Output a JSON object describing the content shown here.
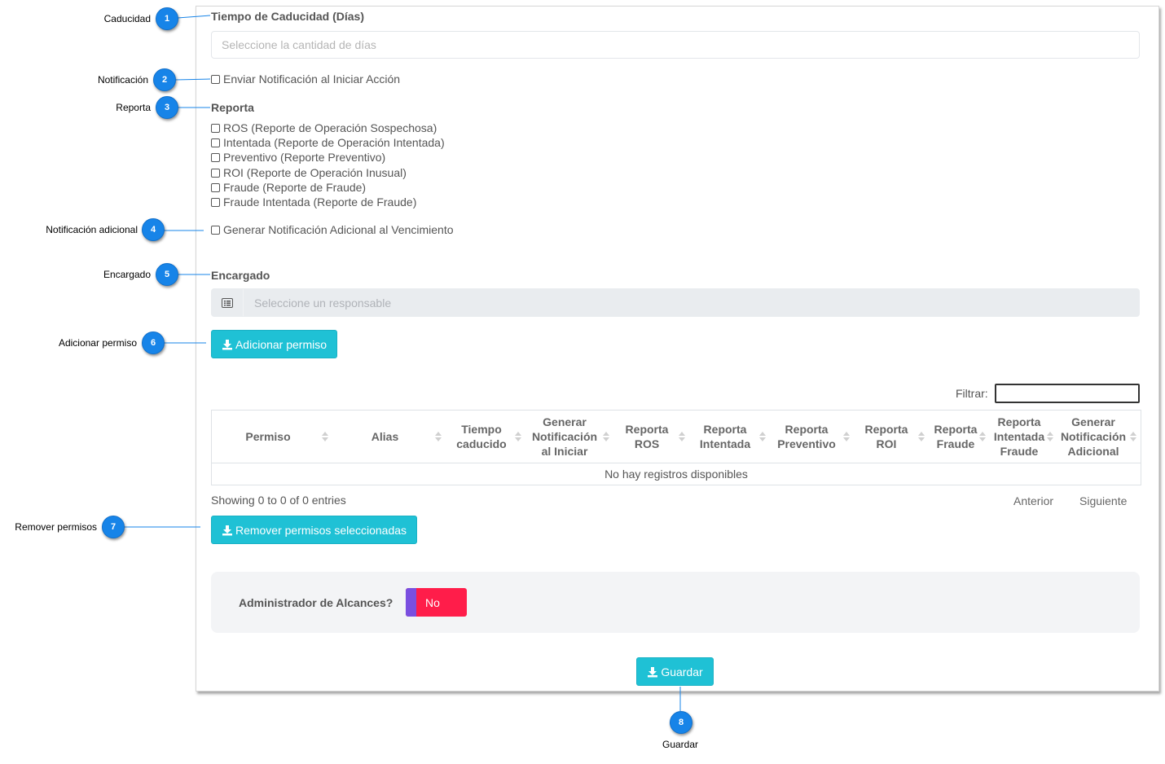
{
  "form": {
    "caducidad_label": "Tiempo de Caducidad (Días)",
    "caducidad_placeholder": "Seleccione la cantidad de días",
    "notificacion_label": "Enviar Notificación al Iniciar Acción",
    "reporta_label": "Reporta",
    "reporta_options": [
      "ROS (Reporte de Operación Sospechosa)",
      "Intentada (Reporte de Operación Intentada)",
      "Preventivo (Reporte Preventivo)",
      "ROI (Reporte de Operación Inusual)",
      "Fraude (Reporte de Fraude)",
      "Fraude Intentada (Reporte de Fraude)"
    ],
    "notificacion_adicional_label": "Generar Notificación Adicional al Vencimiento",
    "encargado_label": "Encargado",
    "encargado_placeholder": "Seleccione un responsable",
    "adicionar_button": "Adicionar permiso",
    "filter_label": "Filtrar:",
    "table_headers": [
      "Permiso",
      "Alias",
      "Tiempo caducido",
      "Generar Notificación al Iniciar",
      "Reporta ROS",
      "Reporta Intentada",
      "Reporta Preventivo",
      "Reporta ROI",
      "Reporta Fraude",
      "Reporta Intentada Fraude",
      "Generar Notificación Adicional"
    ],
    "empty_message": "No hay registros disponibles",
    "showing_text": "Showing 0 to 0 of 0 entries",
    "pagination_prev": "Anterior",
    "pagination_next": "Siguiente",
    "remover_button": "Remover permisos seleccionadas",
    "admin_label": "Administrador de Alcances?",
    "admin_toggle_value": "No",
    "guardar_button": "Guardar"
  },
  "callouts": [
    {
      "num": "1",
      "label": "Caducidad"
    },
    {
      "num": "2",
      "label": "Notificación"
    },
    {
      "num": "3",
      "label": "Reporta"
    },
    {
      "num": "4",
      "label": "Notificación adicional"
    },
    {
      "num": "5",
      "label": "Encargado"
    },
    {
      "num": "6",
      "label": "Adicionar permiso"
    },
    {
      "num": "7",
      "label": "Remover permisos"
    },
    {
      "num": "8",
      "label": "Guardar"
    }
  ],
  "colors": {
    "teal": "#1fc1d5",
    "badge_blue": "#1784e8",
    "toggle_red": "#ff1d4a",
    "toggle_purple": "#7a4fe0"
  }
}
